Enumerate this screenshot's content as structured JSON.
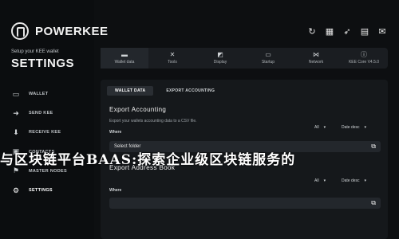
{
  "app": {
    "brand": "POWERKEE",
    "setup_subtitle": "Setup your KEE wallet",
    "settings_title": "SETTINGS"
  },
  "sidebar": {
    "items": [
      {
        "label": "WALLET",
        "icon": "wallet-icon"
      },
      {
        "label": "SEND KEE",
        "icon": "send-icon"
      },
      {
        "label": "RECEIVE KEE",
        "icon": "receive-icon"
      },
      {
        "label": "CONTACTS",
        "icon": "contacts-icon"
      },
      {
        "label": "MASTER NODES",
        "icon": "masternodes-icon"
      },
      {
        "label": "SETTINGS",
        "icon": "gear-icon",
        "active": true
      }
    ]
  },
  "top_icons": [
    "refresh-icon",
    "gift-icon",
    "rocket-icon",
    "lock-icon",
    "mail-icon"
  ],
  "tabs": [
    {
      "label": "Wallet data",
      "icon": "folder-icon",
      "active": true
    },
    {
      "label": "Tools",
      "icon": "tools-icon"
    },
    {
      "label": "Display",
      "icon": "display-icon"
    },
    {
      "label": "Startup",
      "icon": "startup-icon"
    },
    {
      "label": "Network",
      "icon": "network-icon"
    },
    {
      "label": "KEE Core V4.5.0",
      "icon": "info-icon"
    }
  ],
  "subtabs": [
    {
      "label": "WALLET DATA",
      "selected": true
    },
    {
      "label": "EXPORT ACCOUNTING",
      "selected": false
    }
  ],
  "export_accounting": {
    "title": "Export Accounting",
    "description": "Export your wallets accounting data to a CSV file.",
    "where_label": "Where",
    "filter_all": "All",
    "sort": "Date desc",
    "field_placeholder": "Select folder"
  },
  "export_address_book": {
    "title": "Export Address Book",
    "where_label": "Where",
    "filter_all": "All",
    "sort": "Date desc"
  },
  "banner_text": "与区块链平台BAAS:探索企业级区块链服务的"
}
